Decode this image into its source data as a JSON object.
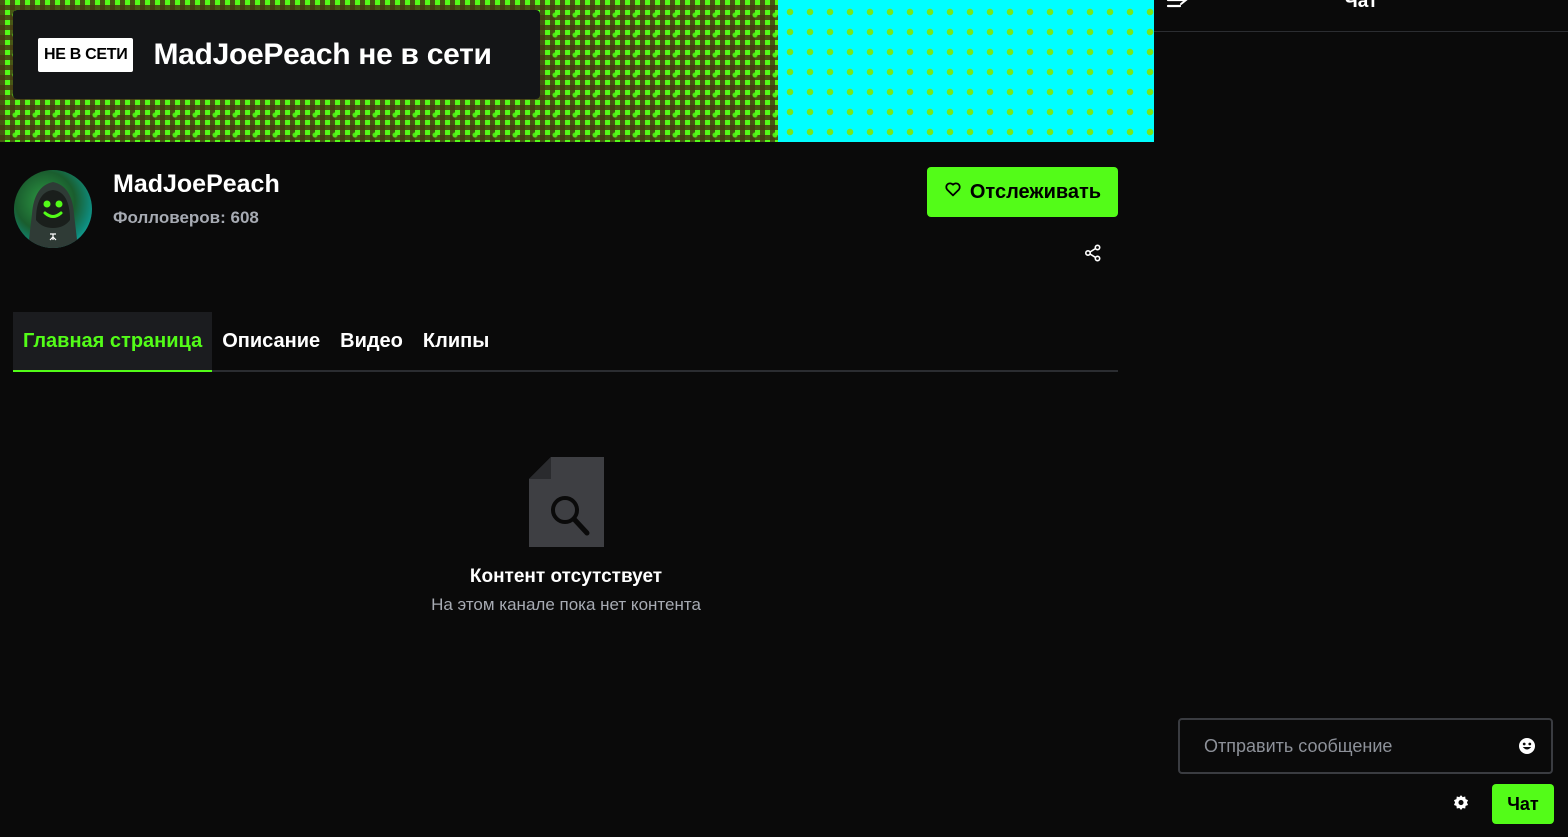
{
  "banner": {
    "offline_badge": "НЕ В СЕТИ",
    "offline_title": "MadJoePeach не в сети"
  },
  "channel": {
    "name": "MadJoePeach",
    "followers": "Фолловеров: 608",
    "follow_label": "Отслеживать"
  },
  "tabs": [
    {
      "label": "Главная страница",
      "active": true
    },
    {
      "label": "Описание",
      "active": false
    },
    {
      "label": "Видео",
      "active": false
    },
    {
      "label": "Клипы",
      "active": false
    }
  ],
  "empty_state": {
    "title": "Контент отсутствует",
    "subtitle": "На этом канале пока нет контента"
  },
  "chat": {
    "title": "Чат",
    "input_placeholder": "Отправить сообщение",
    "send_label": "Чат"
  },
  "colors": {
    "accent": "#53fc18",
    "background": "#0a0a0a",
    "muted_text": "#a7abb3"
  },
  "icons": {
    "follow": "heart-icon",
    "share": "share-icon",
    "empty": "document-search-icon",
    "collapse": "collapse-chat-icon",
    "emoji": "emoji-icon",
    "settings": "gear-icon"
  }
}
